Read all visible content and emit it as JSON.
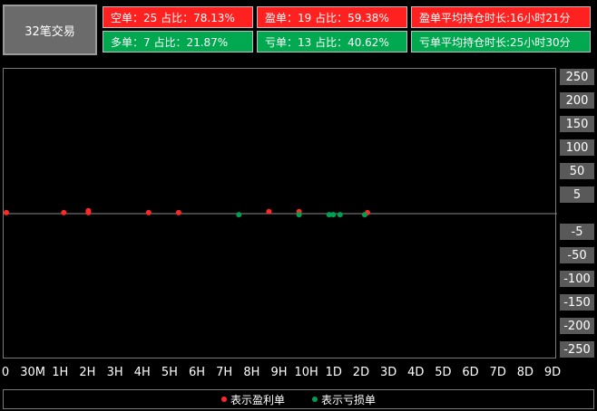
{
  "summary": {
    "label": "32笔交易"
  },
  "stats": {
    "short": "空单：25  占比：78.13%",
    "profit": "盈单：19  占比：59.38%",
    "profit_avg_hold": "盈单平均持仓时长:16小时21分",
    "long": "多单：7  占比：21.87%",
    "loss": "亏单：13  占比：40.62%",
    "loss_avg_hold": "亏单平均持仓时长:25小时30分"
  },
  "colors": {
    "profit": "#ff2828",
    "loss": "#00a050",
    "panel_red": "#ff2020",
    "panel_green": "#00a84f"
  },
  "legend": {
    "profit": "表示盈利单",
    "loss": "表示亏损单"
  },
  "chart_data": {
    "type": "scatter",
    "y_axis": {
      "tick_labels": [
        "250",
        "200",
        "150",
        "100",
        "50",
        "5",
        "-5",
        "-50",
        "-100",
        "-150",
        "-200",
        "-250"
      ],
      "zero_line": true
    },
    "x_axis": {
      "tick_labels": [
        "0",
        "30M",
        "1H",
        "2H",
        "3H",
        "4H",
        "5H",
        "6H",
        "7H",
        "8H",
        "9H",
        "10H",
        "1D",
        "2D",
        "3D",
        "4D",
        "5D",
        "6D",
        "7D",
        "8D",
        "9D"
      ]
    },
    "series": [
      {
        "name": "表示盈利单",
        "points": [
          {
            "x": 0.0,
            "y": 0.5
          },
          {
            "x": 2.1,
            "y": 0.5
          },
          {
            "x": 3.0,
            "y": 1.5
          },
          {
            "x": 3.0,
            "y": 0.5
          },
          {
            "x": 3.0,
            "y": 1.0
          },
          {
            "x": 5.2,
            "y": 0.5
          },
          {
            "x": 6.3,
            "y": 0.5
          },
          {
            "x": 9.6,
            "y": 1.0
          },
          {
            "x": 10.7,
            "y": 1.0
          },
          {
            "x": 13.2,
            "y": 0.5
          }
        ]
      },
      {
        "name": "表示亏损单",
        "points": [
          {
            "x": 8.5,
            "y": -0.5
          },
          {
            "x": 10.7,
            "y": -0.5
          },
          {
            "x": 11.8,
            "y": -0.5
          },
          {
            "x": 11.95,
            "y": -0.5
          },
          {
            "x": 12.2,
            "y": -0.5
          },
          {
            "x": 13.1,
            "y": -0.5
          }
        ]
      }
    ]
  }
}
